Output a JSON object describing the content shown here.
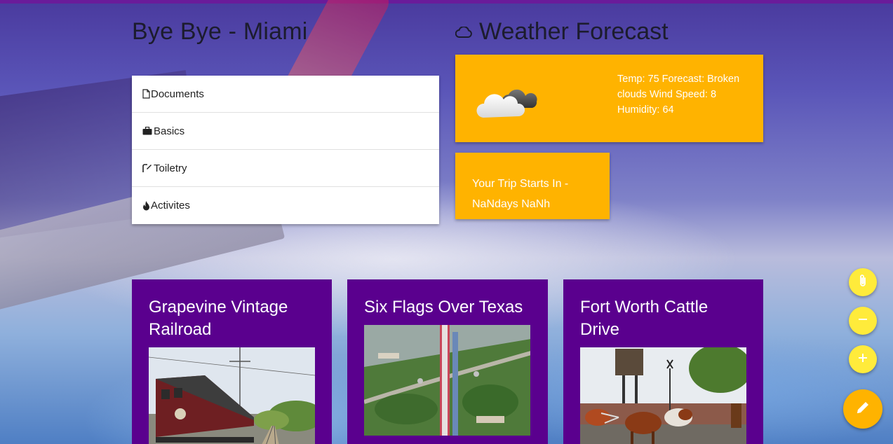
{
  "trip": {
    "title": "Bye Bye - Miami"
  },
  "checklist": [
    {
      "icon": "document-icon",
      "label": "Documents"
    },
    {
      "icon": "briefcase-icon",
      "label": "Basics"
    },
    {
      "icon": "brush-icon",
      "label": "Toiletry"
    },
    {
      "icon": "fire-icon",
      "label": "Activites"
    }
  ],
  "weather": {
    "title": "Weather Forecast",
    "title_icon": "cloud-outline-icon",
    "image_icon": "broken-clouds-icon",
    "details": "Temp: 75 Forecast: Broken clouds Wind Speed: 8 Humidity: 64"
  },
  "countdown": {
    "text": "Your Trip Starts In - NaNdays NaNh"
  },
  "attractions": [
    {
      "title": "Grapevine Vintage Railroad",
      "image": "vintage-train-photo"
    },
    {
      "title": "Six Flags Over Texas",
      "image": "amusement-park-aerial-photo"
    },
    {
      "title": "Fort Worth Cattle Drive",
      "image": "longhorn-cattle-photo"
    }
  ],
  "fabs": [
    {
      "icon": "attach-icon"
    },
    {
      "icon": "minus-icon"
    },
    {
      "icon": "plus-icon"
    },
    {
      "icon": "pencil-icon"
    }
  ],
  "colors": {
    "top_bar": "#6a1b9a",
    "amber": "#ffb300",
    "card_purple": "#5a008e",
    "fab_yellow": "#ffeb3b"
  }
}
